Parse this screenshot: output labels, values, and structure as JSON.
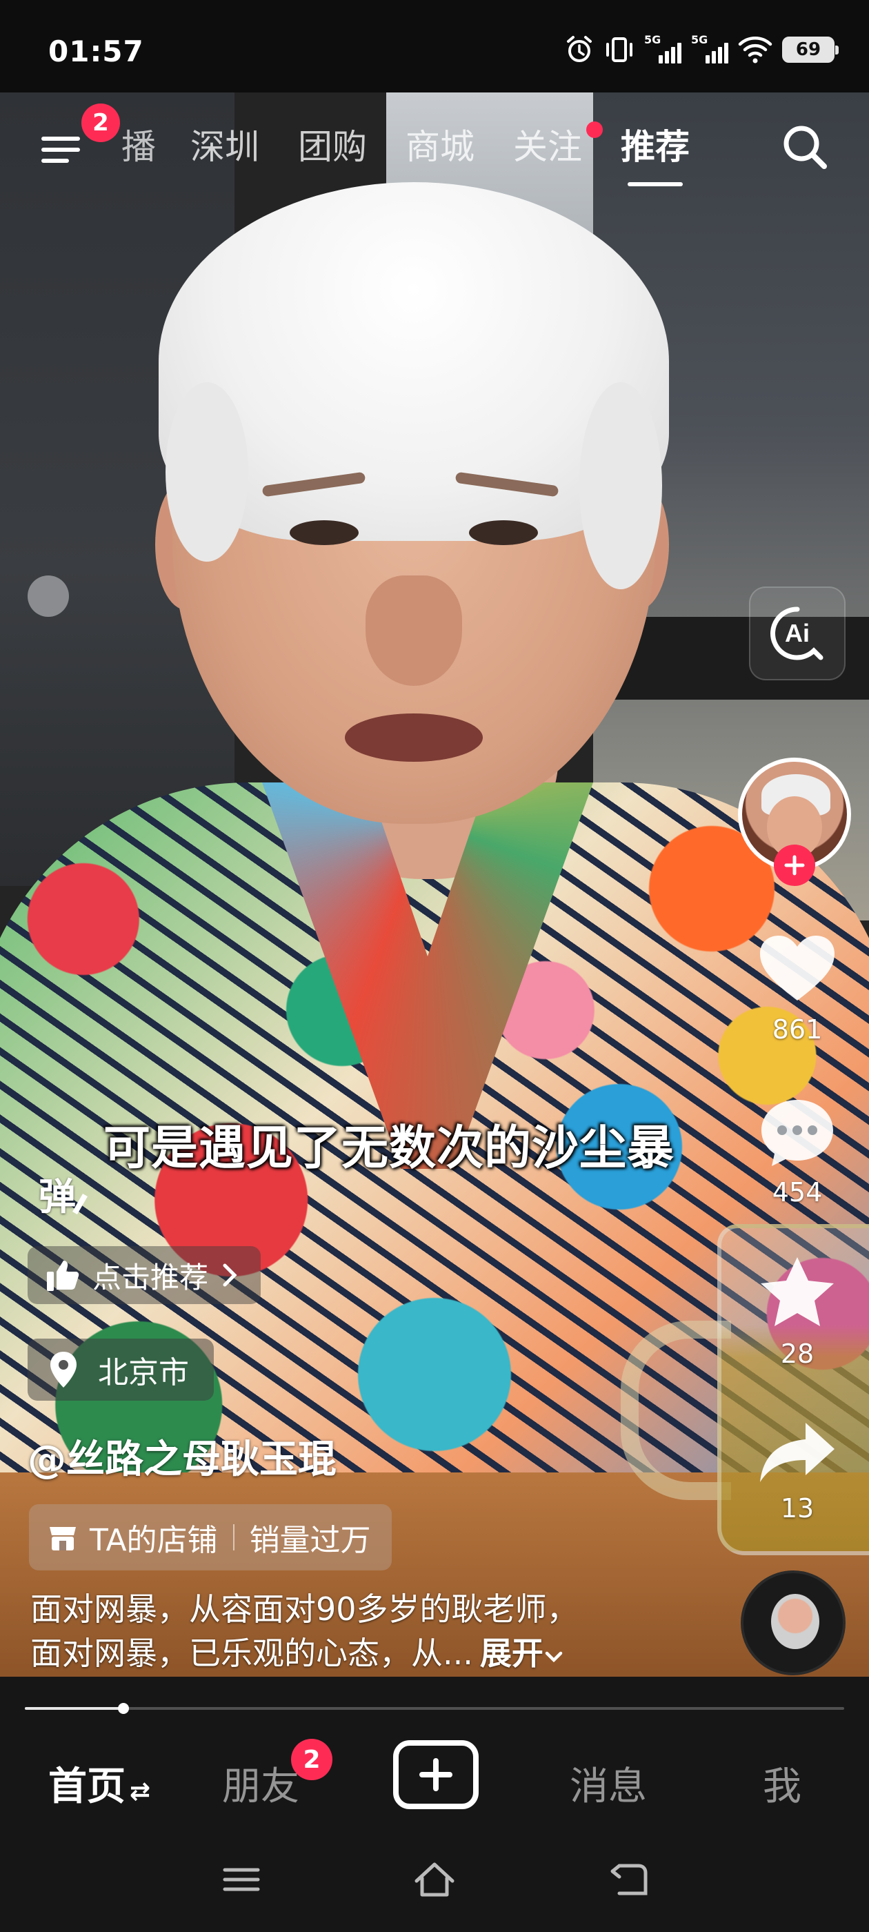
{
  "status_bar": {
    "time": "01:57",
    "network_1": "5G",
    "network_2": "5G",
    "battery": "69"
  },
  "top_nav": {
    "menu_badge": "2",
    "tabs": [
      {
        "label": "直播",
        "visible_label": "播"
      },
      {
        "label": "深圳"
      },
      {
        "label": "团购"
      },
      {
        "label": "商城"
      },
      {
        "label": "关注"
      },
      {
        "label": "推荐"
      }
    ],
    "active_tab": "推荐"
  },
  "video": {
    "subtitle": "可是遇见了无数次的沙尘暴",
    "danmu_label": "弹",
    "recommend_label": "点击推荐",
    "location": "北京市",
    "author": "@丝路之母耿玉琨",
    "shop": {
      "label": "TA的店铺",
      "sales": "销量过万"
    },
    "description": {
      "line1": "面对网暴，从容面对90多岁的耿老师，",
      "line2": "面对网暴，已乐观的心态，从...",
      "expand": "展开"
    },
    "progress": 0.12
  },
  "actions": {
    "ai_label": "Ai",
    "likes": "861",
    "comments": "454",
    "favorites": "28",
    "shares": "13"
  },
  "bottom_nav": {
    "home": "首页",
    "friends": "朋友",
    "friends_badge": "2",
    "messages": "消息",
    "me": "我"
  },
  "colors": {
    "accent": "#fe2c55",
    "background": "#161616",
    "text": "#ffffff"
  },
  "icons": [
    "menu-icon",
    "search-icon",
    "ai-icon",
    "heart-icon",
    "comment-icon",
    "star-icon",
    "share-icon",
    "thumbs-up-icon",
    "location-pin-icon",
    "shop-icon",
    "plus-icon",
    "alarm-icon",
    "vibrate-icon",
    "wifi-icon",
    "battery-icon",
    "sys-menu-icon",
    "sys-home-icon",
    "sys-back-icon"
  ]
}
